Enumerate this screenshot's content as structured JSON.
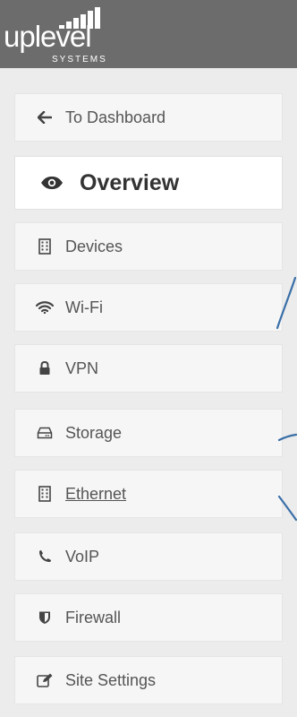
{
  "brand": {
    "logo_text": "uplevel",
    "logo_subtext": "SYSTEMS"
  },
  "colors": {
    "topbar": "#6c6c6c",
    "sidebar_bg": "#ececec",
    "item_bg": "#f6f6f6",
    "active_bg": "#ffffff",
    "text": "#555555",
    "annotation": "#3a6fa8"
  },
  "sidebar": {
    "items": [
      {
        "label": "To Dashboard",
        "icon": "arrow-left-icon",
        "active": false
      },
      {
        "label": "Overview",
        "icon": "eye-icon",
        "active": true
      },
      {
        "label": "Devices",
        "icon": "building-icon",
        "active": false
      },
      {
        "label": "Wi-Fi",
        "icon": "wifi-icon",
        "active": false
      },
      {
        "label": "VPN",
        "icon": "lock-icon",
        "active": false
      },
      {
        "label": "Storage",
        "icon": "hard-drive-icon",
        "active": false
      },
      {
        "label": "Ethernet",
        "icon": "building-icon",
        "active": false,
        "hovered": true
      },
      {
        "label": "VoIP",
        "icon": "phone-icon",
        "active": false
      },
      {
        "label": "Firewall",
        "icon": "shield-icon",
        "active": false
      },
      {
        "label": "Site Settings",
        "icon": "edit-icon",
        "active": false
      }
    ]
  }
}
